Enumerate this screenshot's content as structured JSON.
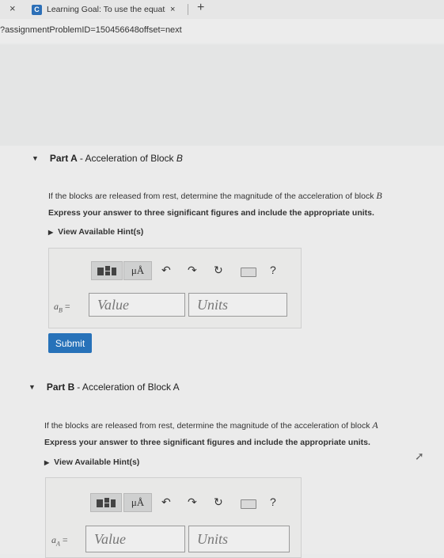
{
  "browser": {
    "tab_close_left": "×",
    "tab_favicon": "C",
    "tab_title": "Learning Goal: To use the equati",
    "tab_close": "×",
    "new_tab": "+",
    "url": "?assignmentProblemID=150456648offset=next"
  },
  "part_a": {
    "label": "Part A",
    "title_prefix": "- Acceleration of Block ",
    "title_block": "B",
    "question_text": "If the blocks are released from rest, determine the magnitude of the acceleration of block ",
    "question_block": "B",
    "instruction": "Express your answer to three significant figures and include the appropriate units.",
    "hint": "View Available Hint(s)",
    "var_label": "a",
    "var_sub": "B",
    "var_eq": " =",
    "value_placeholder": "Value",
    "units_placeholder": "Units",
    "submit_label": "Submit"
  },
  "part_b": {
    "label": "Part B",
    "title_prefix": "- Acceleration of Block A",
    "question_text": "If the blocks are released from rest, determine the magnitude of the acceleration of block ",
    "question_block": "A",
    "instruction": "Express your answer to three significant figures and include the appropriate units.",
    "hint": "View Available Hint(s)",
    "var_label": "a",
    "var_sub": "A",
    "var_eq": " =",
    "value_placeholder": "Value",
    "units_placeholder": "Units"
  },
  "toolbar": {
    "mu_label": "μÅ",
    "undo": "↶",
    "redo": "↷",
    "reset": "↻",
    "help": "?"
  },
  "colors": {
    "submit": "#2772b9",
    "panel_bg": "#e8e8e7",
    "page_bg": "#ebebeb"
  }
}
